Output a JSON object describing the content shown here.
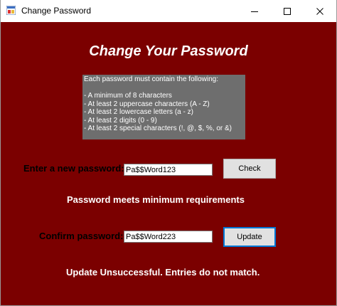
{
  "window": {
    "title": "Change Password",
    "minimize_icon": "minimize-icon",
    "maximize_icon": "maximize-icon",
    "close_icon": "close-icon"
  },
  "main": {
    "heading": "Change Your Password",
    "rules": [
      "Each password must contain the following:",
      "",
      "- A minimum of 8 characters",
      "- At least 2 uppercase characters (A - Z)",
      "- At least 2 lowercase letters (a - z)",
      "- At least 2 digits (0 - 9)",
      "- At least 2 special characters (!, @, $, %, or &)"
    ],
    "new_password_label": "Enter a new password:",
    "new_password_value": "Pa$$Word123",
    "check_button": "Check",
    "check_result": "Password meets minimum requirements",
    "confirm_password_label": "Confirm password:",
    "confirm_password_value": "Pa$$Word223",
    "update_button": "Update",
    "update_result": "Update Unsuccessful.  Entries do not match."
  },
  "colors": {
    "background": "#7b0000",
    "rules_box": "#6e6e6e",
    "focus_border": "#0078d7"
  }
}
